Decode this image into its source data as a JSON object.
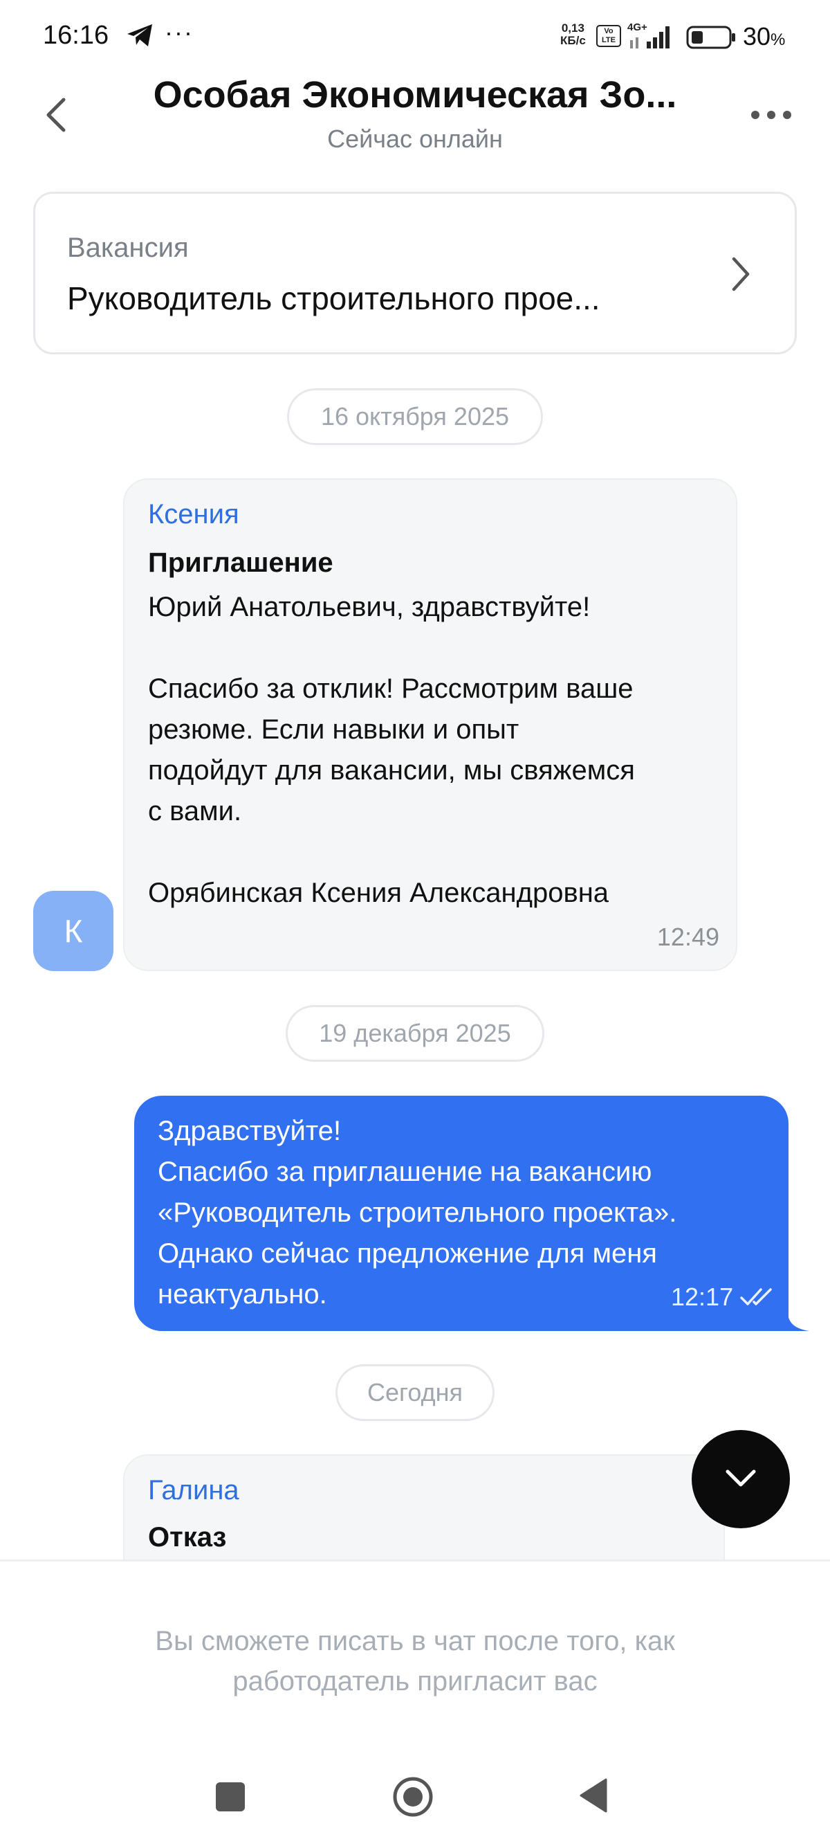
{
  "status_bar": {
    "time": "16:16",
    "dots": "···",
    "speed_value": "0,13",
    "speed_unit": "КБ/с",
    "volte": "Vo LTE",
    "network": "4G+",
    "battery_percent": "30",
    "battery_suffix": "%"
  },
  "header": {
    "title": "Особая Экономическая Зо...",
    "subtitle": "Сейчас онлайн"
  },
  "vacancy": {
    "label": "Вакансия",
    "title": "Руководитель строительного прое..."
  },
  "messages": [
    {
      "date": "16 октября 2025",
      "sender": "Ксения",
      "title": "Приглашение",
      "body": "Юрий Анатольевич, здравствуйте!\n\nСпасибо за отклик! Рассмотрим ваше\nрезюме. Если навыки и опыт\nподойдут для вакансии, мы свяжемся\nс вами.\n\nОрябинская Ксения Александровна",
      "time": "12:49",
      "avatar_letter": "К"
    },
    {
      "date": "19 декабря 2025",
      "body": "Здравствуйте!\nСпасибо за приглашение на вакансию\n«Руководитель строительного проекта».\nОднако сейчас предложение для меня\nнеактуально.",
      "time": "12:17"
    },
    {
      "date": "Сегодня",
      "sender": "Галина",
      "title": "Отказ"
    }
  ],
  "footer": {
    "line1": "Вы сможете писать в чат после того, как",
    "line2": "работодатель пригласит вас"
  },
  "colors": {
    "accent": "#3170f0",
    "sender_name": "#2f6fe0",
    "avatar": "#86b1f7"
  }
}
